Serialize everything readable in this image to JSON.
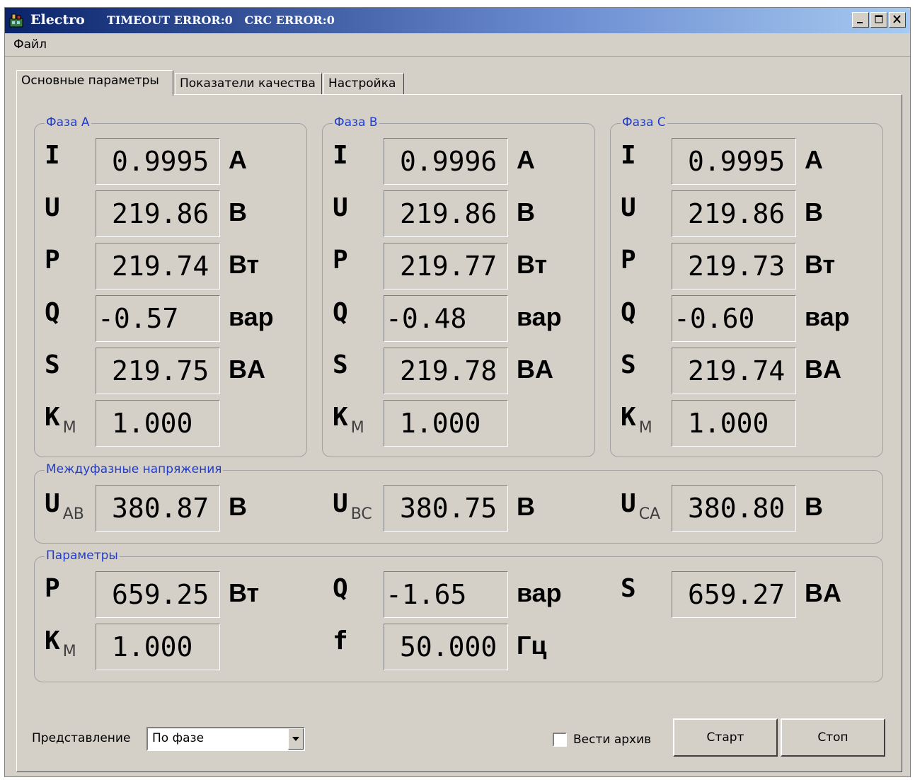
{
  "window": {
    "app_title": "Electro",
    "status": "TIMEOUT ERROR:0   CRC ERROR:0"
  },
  "menu": {
    "file": "Файл"
  },
  "tabs": [
    {
      "label": "Основные параметры",
      "active": true
    },
    {
      "label": "Показатели качества",
      "active": false
    },
    {
      "label": "Настройка",
      "active": false
    }
  ],
  "phases": [
    {
      "title": "Фаза A",
      "rows": [
        {
          "label": "I",
          "sub": "",
          "value": "0.9995",
          "unit": "A"
        },
        {
          "label": "U",
          "sub": "",
          "value": "219.86",
          "unit": "B"
        },
        {
          "label": "P",
          "sub": "",
          "value": "219.74",
          "unit": "Вт"
        },
        {
          "label": "Q",
          "sub": "",
          "value": "-0.57",
          "unit": "вар"
        },
        {
          "label": "S",
          "sub": "",
          "value": "219.75",
          "unit": "BA"
        },
        {
          "label": "K",
          "sub": "M",
          "value": "1.000",
          "unit": ""
        }
      ]
    },
    {
      "title": "Фаза B",
      "rows": [
        {
          "label": "I",
          "sub": "",
          "value": "0.9996",
          "unit": "A"
        },
        {
          "label": "U",
          "sub": "",
          "value": "219.86",
          "unit": "B"
        },
        {
          "label": "P",
          "sub": "",
          "value": "219.77",
          "unit": "Вт"
        },
        {
          "label": "Q",
          "sub": "",
          "value": "-0.48",
          "unit": "вар"
        },
        {
          "label": "S",
          "sub": "",
          "value": "219.78",
          "unit": "BA"
        },
        {
          "label": "K",
          "sub": "M",
          "value": "1.000",
          "unit": ""
        }
      ]
    },
    {
      "title": "Фаза C",
      "rows": [
        {
          "label": "I",
          "sub": "",
          "value": "0.9995",
          "unit": "A"
        },
        {
          "label": "U",
          "sub": "",
          "value": "219.86",
          "unit": "B"
        },
        {
          "label": "P",
          "sub": "",
          "value": "219.73",
          "unit": "Вт"
        },
        {
          "label": "Q",
          "sub": "",
          "value": "-0.60",
          "unit": "вар"
        },
        {
          "label": "S",
          "sub": "",
          "value": "219.74",
          "unit": "BA"
        },
        {
          "label": "K",
          "sub": "M",
          "value": "1.000",
          "unit": ""
        }
      ]
    }
  ],
  "line_voltages": {
    "title": "Междуфазные напряжения",
    "items": [
      {
        "label": "U",
        "sub": "AB",
        "value": "380.87",
        "unit": "B"
      },
      {
        "label": "U",
        "sub": "BC",
        "value": "380.75",
        "unit": "B"
      },
      {
        "label": "U",
        "sub": "CA",
        "value": "380.80",
        "unit": "B"
      }
    ]
  },
  "params": {
    "title": "Параметры",
    "row1": [
      {
        "label": "P",
        "sub": "",
        "value": "659.25",
        "unit": "Вт"
      },
      {
        "label": "Q",
        "sub": "",
        "value": "-1.65",
        "unit": "вар"
      },
      {
        "label": "S",
        "sub": "",
        "value": "659.27",
        "unit": "BA"
      }
    ],
    "row2": [
      {
        "label": "K",
        "sub": "M",
        "value": "1.000",
        "unit": ""
      },
      {
        "label": "f",
        "sub": "",
        "value": "50.000",
        "unit": "Гц"
      }
    ]
  },
  "bottom": {
    "view_label": "Представление",
    "view_value": "По фазе",
    "archive_label": "Вести архив",
    "archive_checked": false,
    "start_label": "Старт",
    "stop_label": "Стоп"
  }
}
